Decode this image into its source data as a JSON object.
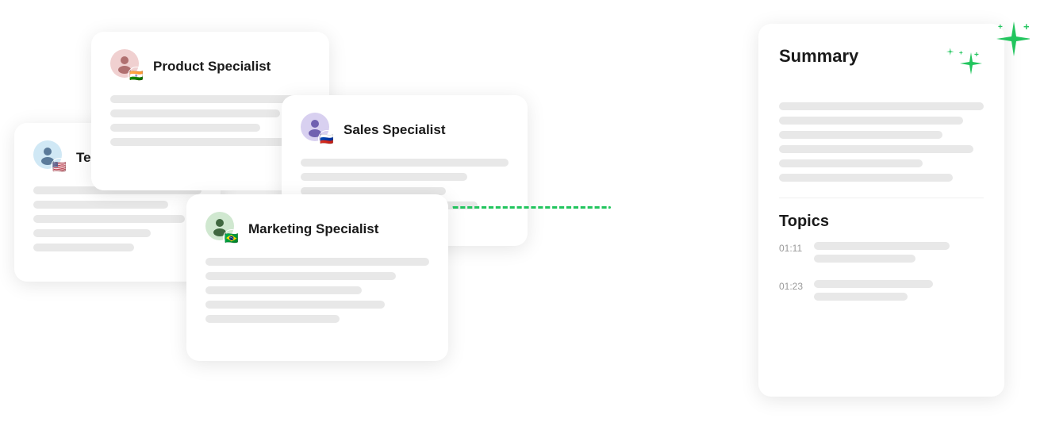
{
  "cards": {
    "team_lead": {
      "title": "Team Lead",
      "flag": "🇺🇸",
      "person_bg": "#d0e8f5",
      "lines": [
        100,
        80,
        90,
        70,
        60
      ]
    },
    "product": {
      "title": "Product Specialist",
      "flag": "🇮🇳",
      "person_bg": "#f0d0d0",
      "lines": [
        100,
        85,
        75,
        90
      ]
    },
    "sales": {
      "title": "Sales Specialist",
      "flag": "🇷🇺",
      "person_bg": "#d8d0f0",
      "lines": [
        100,
        80,
        70,
        85
      ]
    },
    "marketing": {
      "title": "Marketing Specialist",
      "flag": "🇧🇷",
      "person_bg": "#d0e8d0",
      "lines": [
        100,
        85,
        70,
        80,
        60
      ]
    }
  },
  "summary": {
    "title": "Summary",
    "topics_title": "Topics",
    "topic1_time": "01:11",
    "topic2_time": "01:23",
    "summary_lines": [
      100,
      90,
      80,
      95,
      70,
      85
    ],
    "topic1_lines": [
      80,
      60
    ],
    "topic2_lines": [
      70,
      55
    ]
  }
}
